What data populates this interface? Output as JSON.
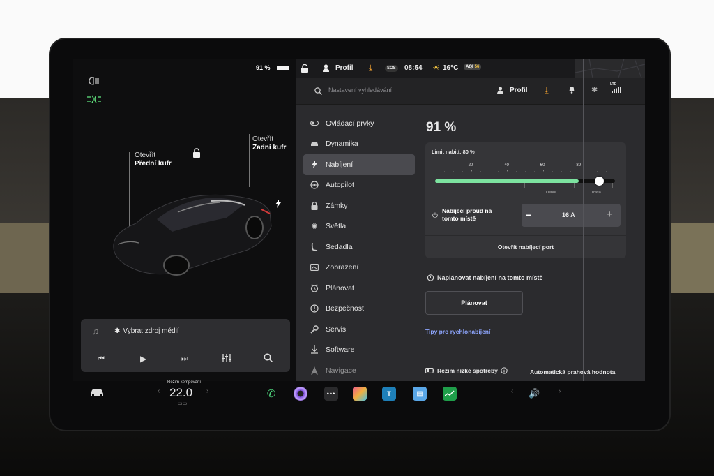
{
  "status": {
    "battery_pct": "91 %",
    "profile_label": "Profil",
    "sos_label": "SOS",
    "time": "08:54",
    "temperature": "16°C",
    "aqi_label": "AQI",
    "aqi_value": "56"
  },
  "left_panel": {
    "front_trunk_state": "Otevřít",
    "front_trunk_label": "Přední kufr",
    "rear_trunk_state": "Otevřít",
    "rear_trunk_label": "Zadní kufr",
    "media_source": "Vybrat zdroj médií"
  },
  "search": {
    "placeholder": "Nastavení vyhledávání",
    "profile_label": "Profil",
    "signal_label": "LTE"
  },
  "nav": {
    "items": [
      {
        "label": "Ovládací prvky",
        "icon": "toggle-icon"
      },
      {
        "label": "Dynamika",
        "icon": "car-icon"
      },
      {
        "label": "Nabíjení",
        "icon": "bolt-icon"
      },
      {
        "label": "Autopilot",
        "icon": "steering-wheel-icon"
      },
      {
        "label": "Zámky",
        "icon": "lock-icon"
      },
      {
        "label": "Světla",
        "icon": "sun-icon"
      },
      {
        "label": "Sedadla",
        "icon": "seat-icon"
      },
      {
        "label": "Zobrazení",
        "icon": "display-icon"
      },
      {
        "label": "Plánovat",
        "icon": "alarm-clock-icon"
      },
      {
        "label": "Bezpečnost",
        "icon": "info-circle-icon"
      },
      {
        "label": "Servis",
        "icon": "wrench-icon"
      },
      {
        "label": "Software",
        "icon": "download-icon"
      },
      {
        "label": "Navigace",
        "icon": "navigation-icon"
      }
    ],
    "active_index": 2
  },
  "charging": {
    "battery_pct": "91 %",
    "limit_label": "Limit nabití: 80 %",
    "ticks": [
      "20",
      "40",
      "60",
      "80"
    ],
    "range_daily": "Denní",
    "range_trip": "Trasa",
    "current_level": 0.91,
    "limit_level": 0.8,
    "current_label": "Nabíjecí proud na tomto místě",
    "current_value": "16 A",
    "open_port_label": "Otevřít nabíjecí port",
    "schedule_label": "Naplánovat nabíjení na tomto místě",
    "schedule_button": "Plánovat",
    "tips_link": "Tipy pro rychlonabíjení",
    "low_power_label": "Režim nízké spotřeby",
    "auto_threshold_label": "Automatická prahová hodnota"
  },
  "bottom_bar": {
    "camping_label": "Režim kempování",
    "temp_value": "22.0"
  },
  "colors": {
    "accent_green": "#7de3a0",
    "link_blue": "#8ea6ff",
    "download_orange": "#f0a030"
  }
}
